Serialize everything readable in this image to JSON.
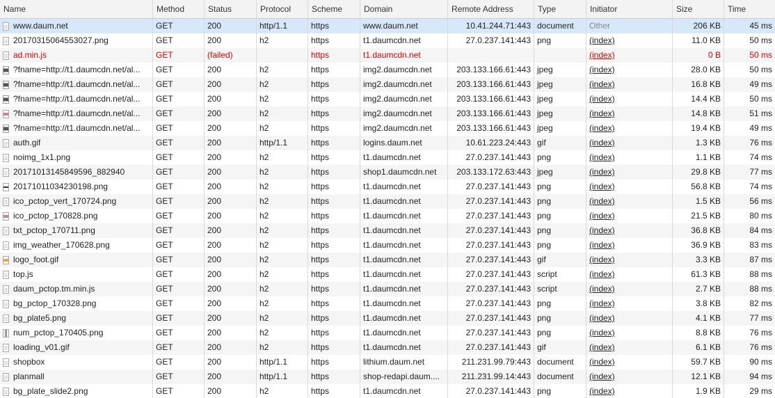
{
  "columns": {
    "name": "Name",
    "method": "Method",
    "status": "Status",
    "protocol": "Protocol",
    "scheme": "Scheme",
    "domain": "Domain",
    "remote": "Remote Address",
    "type": "Type",
    "initiator": "Initiator",
    "size": "Size",
    "time": "Time"
  },
  "rows": [
    {
      "icon": "doc",
      "name": "www.daum.net",
      "method": "GET",
      "status": "200",
      "protocol": "http/1.1",
      "scheme": "https",
      "domain": "www.daum.net",
      "remote": "10.41.244.71:443",
      "type": "document",
      "initiator": "Other",
      "size": "206 KB",
      "time": "45 ms",
      "selected": true
    },
    {
      "icon": "doc",
      "name": "20170315064553027.png",
      "method": "GET",
      "status": "200",
      "protocol": "h2",
      "scheme": "https",
      "domain": "t1.daumcdn.net",
      "remote": "27.0.237.141:443",
      "type": "png",
      "initiator": "(index)",
      "size": "11.0 KB",
      "time": "50 ms"
    },
    {
      "icon": "doc",
      "name": "ad.min.js",
      "method": "GET",
      "status": "(failed)",
      "protocol": "",
      "scheme": "https",
      "domain": "t1.daumcdn.net",
      "remote": "",
      "type": "",
      "initiator": "(index)",
      "size": "0 B",
      "time": "50 ms",
      "failed": true
    },
    {
      "icon": "img",
      "name": "?fname=http://t1.daumcdn.net/al...",
      "method": "GET",
      "status": "200",
      "protocol": "h2",
      "scheme": "https",
      "domain": "img2.daumcdn.net",
      "remote": "203.133.166.61:443",
      "type": "jpeg",
      "initiator": "(index)",
      "size": "28.0 KB",
      "time": "50 ms"
    },
    {
      "icon": "img",
      "name": "?fname=http://t1.daumcdn.net/al...",
      "method": "GET",
      "status": "200",
      "protocol": "h2",
      "scheme": "https",
      "domain": "img2.daumcdn.net",
      "remote": "203.133.166.61:443",
      "type": "jpeg",
      "initiator": "(index)",
      "size": "16.8 KB",
      "time": "49 ms"
    },
    {
      "icon": "img",
      "name": "?fname=http://t1.daumcdn.net/al...",
      "method": "GET",
      "status": "200",
      "protocol": "h2",
      "scheme": "https",
      "domain": "img2.daumcdn.net",
      "remote": "203.133.166.61:443",
      "type": "jpeg",
      "initiator": "(index)",
      "size": "14.4 KB",
      "time": "50 ms"
    },
    {
      "icon": "img2",
      "name": "?fname=http://t1.daumcdn.net/al...",
      "method": "GET",
      "status": "200",
      "protocol": "h2",
      "scheme": "https",
      "domain": "img2.daumcdn.net",
      "remote": "203.133.166.61:443",
      "type": "jpeg",
      "initiator": "(index)",
      "size": "14.8 KB",
      "time": "51 ms"
    },
    {
      "icon": "img",
      "name": "?fname=http://t1.daumcdn.net/al...",
      "method": "GET",
      "status": "200",
      "protocol": "h2",
      "scheme": "https",
      "domain": "img2.daumcdn.net",
      "remote": "203.133.166.61:443",
      "type": "jpeg",
      "initiator": "(index)",
      "size": "19.4 KB",
      "time": "49 ms"
    },
    {
      "icon": "doc",
      "name": "auth.gif",
      "method": "GET",
      "status": "200",
      "protocol": "http/1.1",
      "scheme": "https",
      "domain": "logins.daum.net",
      "remote": "10.61.223.24:443",
      "type": "gif",
      "initiator": "(index)",
      "size": "1.3 KB",
      "time": "76 ms"
    },
    {
      "icon": "doc",
      "name": "noimg_1x1.png",
      "method": "GET",
      "status": "200",
      "protocol": "h2",
      "scheme": "https",
      "domain": "t1.daumcdn.net",
      "remote": "27.0.237.141:443",
      "type": "png",
      "initiator": "(index)",
      "size": "1.1 KB",
      "time": "74 ms"
    },
    {
      "icon": "doc",
      "name": "20171013145849596_882940",
      "method": "GET",
      "status": "200",
      "protocol": "h2",
      "scheme": "https",
      "domain": "shop1.daumcdn.net",
      "remote": "203.133.172.63:443",
      "type": "jpeg",
      "initiator": "(index)",
      "size": "29.8 KB",
      "time": "77 ms"
    },
    {
      "icon": "bar",
      "name": "20171011034230198.png",
      "method": "GET",
      "status": "200",
      "protocol": "h2",
      "scheme": "https",
      "domain": "t1.daumcdn.net",
      "remote": "27.0.237.141:443",
      "type": "png",
      "initiator": "(index)",
      "size": "56.8 KB",
      "time": "74 ms"
    },
    {
      "icon": "doc",
      "name": "ico_pctop_vert_170724.png",
      "method": "GET",
      "status": "200",
      "protocol": "h2",
      "scheme": "https",
      "domain": "t1.daumcdn.net",
      "remote": "27.0.237.141:443",
      "type": "png",
      "initiator": "(index)",
      "size": "1.5 KB",
      "time": "56 ms"
    },
    {
      "icon": "img2",
      "name": "ico_pctop_170828.png",
      "method": "GET",
      "status": "200",
      "protocol": "h2",
      "scheme": "https",
      "domain": "t1.daumcdn.net",
      "remote": "27.0.237.141:443",
      "type": "png",
      "initiator": "(index)",
      "size": "21.5 KB",
      "time": "80 ms"
    },
    {
      "icon": "doc",
      "name": "txt_pctop_170711.png",
      "method": "GET",
      "status": "200",
      "protocol": "h2",
      "scheme": "https",
      "domain": "t1.daumcdn.net",
      "remote": "27.0.237.141:443",
      "type": "png",
      "initiator": "(index)",
      "size": "36.8 KB",
      "time": "84 ms"
    },
    {
      "icon": "doc",
      "name": "img_weather_170628.png",
      "method": "GET",
      "status": "200",
      "protocol": "h2",
      "scheme": "https",
      "domain": "t1.daumcdn.net",
      "remote": "27.0.237.141:443",
      "type": "png",
      "initiator": "(index)",
      "size": "36.9 KB",
      "time": "83 ms"
    },
    {
      "icon": "gif",
      "name": "logo_foot.gif",
      "method": "GET",
      "status": "200",
      "protocol": "h2",
      "scheme": "https",
      "domain": "t1.daumcdn.net",
      "remote": "27.0.237.141:443",
      "type": "gif",
      "initiator": "(index)",
      "size": "3.3 KB",
      "time": "87 ms"
    },
    {
      "icon": "doc",
      "name": "top.js",
      "method": "GET",
      "status": "200",
      "protocol": "h2",
      "scheme": "https",
      "domain": "t1.daumcdn.net",
      "remote": "27.0.237.141:443",
      "type": "script",
      "initiator": "(index)",
      "size": "61.3 KB",
      "time": "88 ms"
    },
    {
      "icon": "doc",
      "name": "daum_pctop.tm.min.js",
      "method": "GET",
      "status": "200",
      "protocol": "h2",
      "scheme": "https",
      "domain": "t1.daumcdn.net",
      "remote": "27.0.237.141:443",
      "type": "script",
      "initiator": "(index)",
      "size": "2.7 KB",
      "time": "88 ms"
    },
    {
      "icon": "doc",
      "name": "bg_pctop_170328.png",
      "method": "GET",
      "status": "200",
      "protocol": "h2",
      "scheme": "https",
      "domain": "t1.daumcdn.net",
      "remote": "27.0.237.141:443",
      "type": "png",
      "initiator": "(index)",
      "size": "3.8 KB",
      "time": "82 ms"
    },
    {
      "icon": "doc",
      "name": "bg_plate5.png",
      "method": "GET",
      "status": "200",
      "protocol": "h2",
      "scheme": "https",
      "domain": "t1.daumcdn.net",
      "remote": "27.0.237.141:443",
      "type": "png",
      "initiator": "(index)",
      "size": "4.1 KB",
      "time": "77 ms"
    },
    {
      "icon": "vert",
      "name": "num_pctop_170405.png",
      "method": "GET",
      "status": "200",
      "protocol": "h2",
      "scheme": "https",
      "domain": "t1.daumcdn.net",
      "remote": "27.0.237.141:443",
      "type": "png",
      "initiator": "(index)",
      "size": "8.8 KB",
      "time": "76 ms"
    },
    {
      "icon": "doc",
      "name": "loading_v01.gif",
      "method": "GET",
      "status": "200",
      "protocol": "h2",
      "scheme": "https",
      "domain": "t1.daumcdn.net",
      "remote": "27.0.237.141:443",
      "type": "gif",
      "initiator": "(index)",
      "size": "6.1 KB",
      "time": "76 ms"
    },
    {
      "icon": "doc",
      "name": "shopbox",
      "method": "GET",
      "status": "200",
      "protocol": "http/1.1",
      "scheme": "https",
      "domain": "lithium.daum.net",
      "remote": "211.231.99.79:443",
      "type": "document",
      "initiator": "(index)",
      "size": "59.7 KB",
      "time": "90 ms"
    },
    {
      "icon": "doc",
      "name": "planmall",
      "method": "GET",
      "status": "200",
      "protocol": "http/1.1",
      "scheme": "https",
      "domain": "shop-redapi.daum....",
      "remote": "211.231.99.14:443",
      "type": "document",
      "initiator": "(index)",
      "size": "12.1 KB",
      "time": "94 ms"
    },
    {
      "icon": "doc",
      "name": "bg_plate_slide2.png",
      "method": "GET",
      "status": "200",
      "protocol": "h2",
      "scheme": "https",
      "domain": "t1.daumcdn.net",
      "remote": "27.0.237.141:443",
      "type": "png",
      "initiator": "(index)",
      "size": "1.9 KB",
      "time": "29 ms"
    }
  ]
}
